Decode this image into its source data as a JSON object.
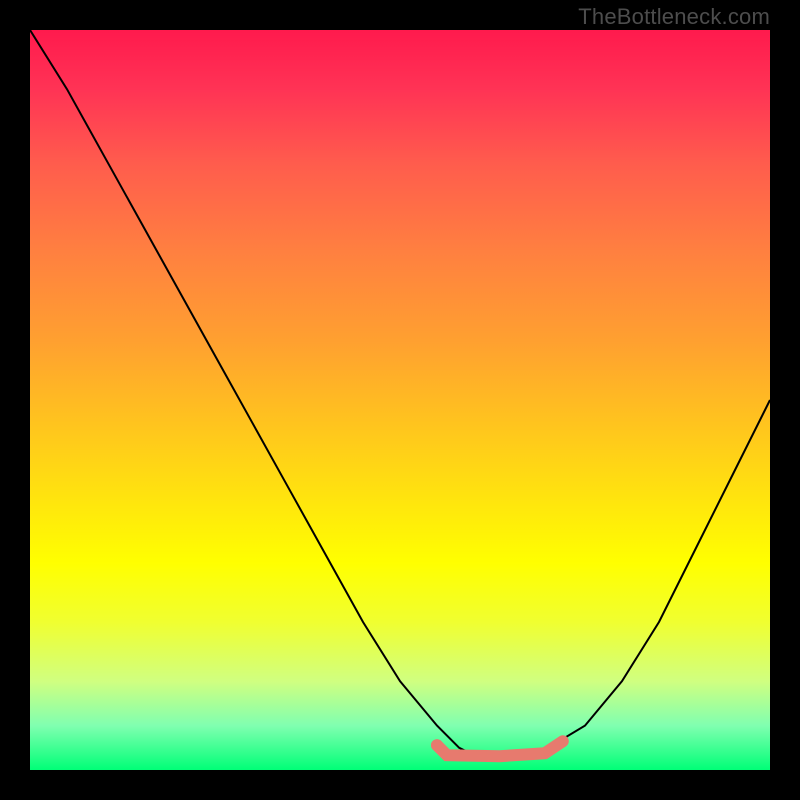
{
  "watermark": "TheBottleneck.com",
  "colors": {
    "curve": "#000000",
    "highlight": "#e77a6e",
    "background": "#000000"
  },
  "chart_data": {
    "type": "line",
    "title": "",
    "xlabel": "",
    "ylabel": "",
    "xlim": [
      0,
      100
    ],
    "ylim": [
      0,
      100
    ],
    "series": [
      {
        "name": "curve",
        "x": [
          0,
          5,
          10,
          15,
          20,
          25,
          30,
          35,
          40,
          45,
          50,
          55,
          58,
          60,
          62,
          65,
          70,
          75,
          80,
          85,
          90,
          95,
          100
        ],
        "y": [
          100,
          92,
          83,
          74,
          65,
          56,
          47,
          38,
          29,
          20,
          12,
          6,
          3,
          2,
          2,
          2,
          3,
          6,
          12,
          20,
          30,
          40,
          50
        ]
      }
    ],
    "highlight_range_x": [
      55,
      72
    ],
    "highlight_y": 2
  }
}
